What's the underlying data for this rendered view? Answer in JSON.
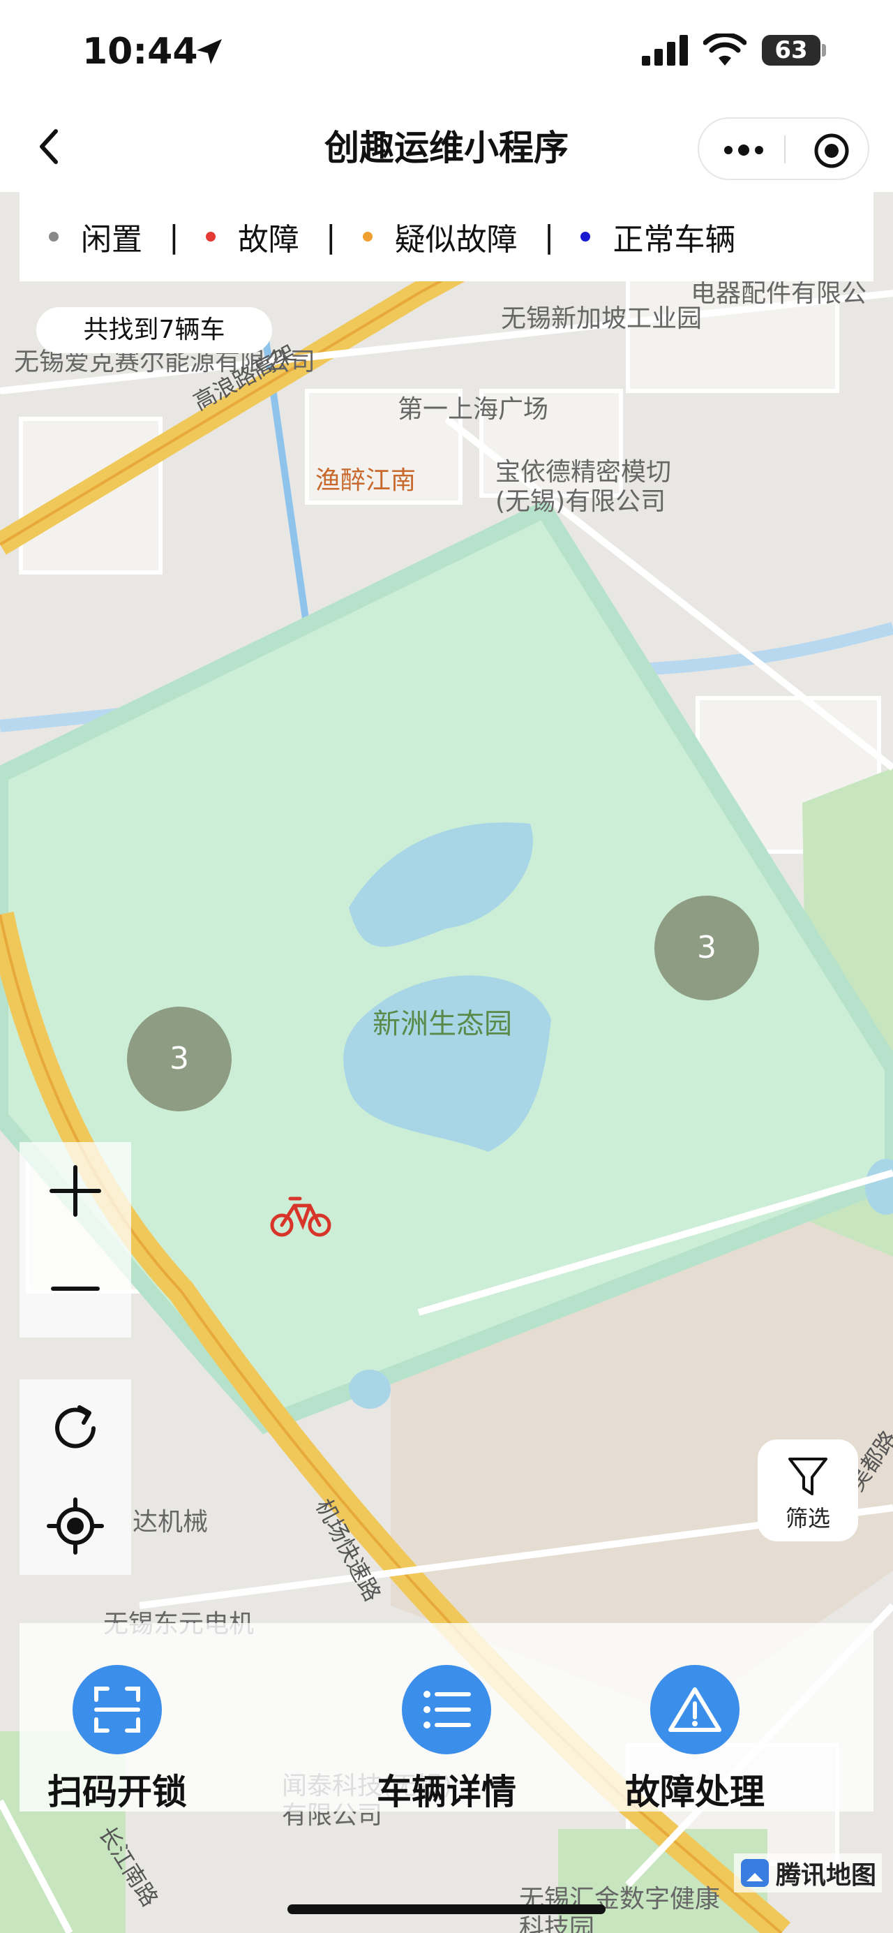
{
  "status_bar": {
    "time": "10:44",
    "battery": "63"
  },
  "navbar": {
    "title": "创趣运维小程序"
  },
  "legend": [
    {
      "label": "闲置",
      "color": "#888888"
    },
    {
      "label": "故障",
      "color": "#e53935"
    },
    {
      "label": "疑似故障",
      "color": "#f0a030"
    },
    {
      "label": "正常车辆",
      "color": "#1a1ad0"
    }
  ],
  "found_text": "共找到7辆车",
  "clusters": [
    {
      "count": "3"
    },
    {
      "count": "3"
    }
  ],
  "filter": {
    "label": "筛选"
  },
  "actions": [
    {
      "label": "扫码开锁",
      "icon": "scan-icon"
    },
    {
      "label": "车辆详情",
      "icon": "list-icon"
    },
    {
      "label": "故障处理",
      "icon": "warning-icon"
    }
  ],
  "map_labels": {
    "park": "新洲生态园",
    "road1": "高浪路高架",
    "poi1": "第一上海广场",
    "poi2": "渔醉江南",
    "poi3": "宝依德精密模切(无锡)有限公司",
    "poi4": "无锡新加坡工业园",
    "poi5": "无锡爱克赛尔能源有限公司",
    "poi6": "电器配件有限公",
    "poi7": "无锡东元电机",
    "poi8": "达机械",
    "poi9": "闻泰科技(无锡)有限公司",
    "poi10": "无锡汇金数字健康科技园",
    "road2": "机场快速路",
    "road3": "长江南路",
    "road4": "吴都路"
  },
  "map_attribution": "腾讯地图"
}
